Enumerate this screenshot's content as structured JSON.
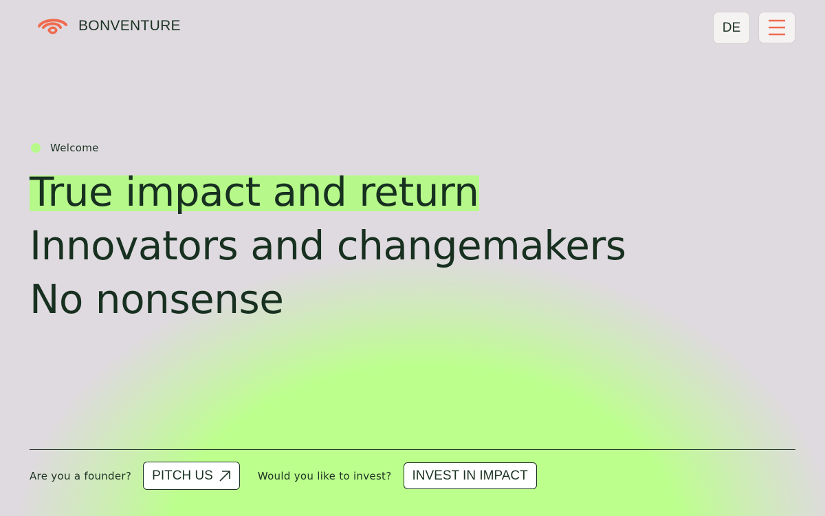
{
  "brand": {
    "name": "BONVENTURE",
    "logo_icon": "bonventure-swirl-logo",
    "accent_color": "#ef6a4f",
    "highlight_color": "#b6f98a",
    "text_color": "#1c3324",
    "background_color": "#dfdadf"
  },
  "header": {
    "language_label": "DE",
    "menu_icon": "hamburger-menu-icon"
  },
  "hero": {
    "eyebrow": "Welcome",
    "lines": [
      "True impact and return",
      "Innovators and changemakers",
      "No nonsense"
    ]
  },
  "cta": {
    "founder_question": "Are you a founder?",
    "pitch_label": "PITCH US",
    "pitch_icon": "arrow-up-right-icon",
    "investor_question": "Would you like to invest?",
    "invest_label": "INVEST IN IMPACT"
  }
}
